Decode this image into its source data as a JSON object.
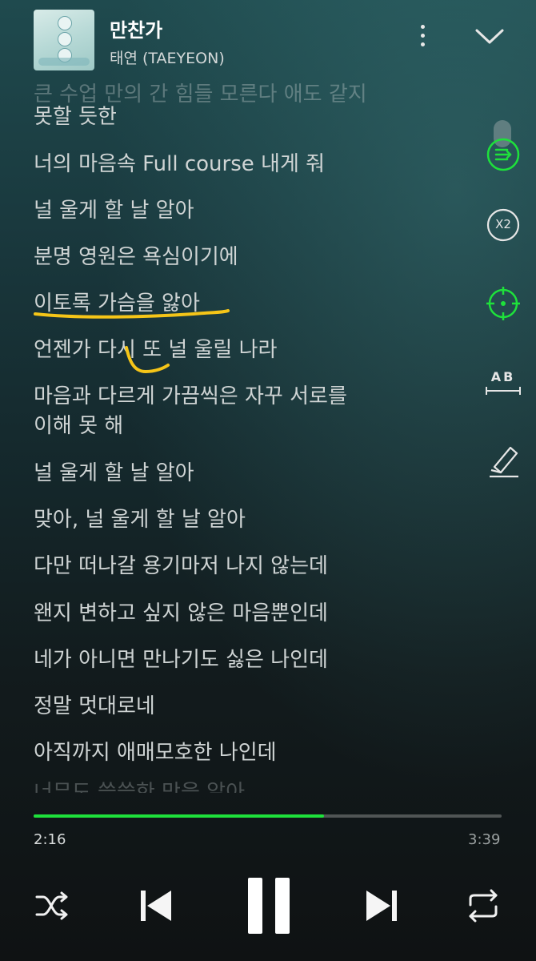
{
  "header": {
    "title": "만찬가",
    "artist": "태연 (TAEYEON)",
    "more_icon": "more-vertical-icon",
    "collapse_icon": "chevron-down-icon"
  },
  "lyrics": [
    "큰 수업 만의 간 힘들 모른다 애도 같지",
    "못할 듯한",
    "너의 마음속 Full course 내게 줘",
    "널 울게 할 날 알아",
    "분명 영원은 욕심이기에",
    "이토록 가슴을 앓아",
    "언젠가 다시 또 널 울릴 나라",
    "마음과 다르게 가끔씩은 자꾸 서로를",
    "이해 못 해",
    "널 울게 할 날 알아",
    "맞아, 널 울게 할 날 알아",
    "다만 떠나갈 용기마저 나지 않는데",
    "왠지 변하고 싶지 않은 마음뿐인데",
    "네가 아니면 만나기도 싫은 나인데",
    "정말 멋대로네",
    "아직까지 애매모호한 나인데",
    "너무도 쓸쓸한 맛을 알아"
  ],
  "tools": {
    "autoscroll": "lyrics-autoscroll-icon",
    "speed": "X2",
    "focus": "target-focus-icon",
    "font": "AB",
    "highlight": "highlighter-icon"
  },
  "progress": {
    "current": "2:16",
    "total": "3:39",
    "fraction": 0.621,
    "color": "#1ee13b"
  },
  "controls": {
    "shuffle": "shuffle-icon",
    "previous": "skip-previous-icon",
    "play_pause": "pause-icon",
    "next": "skip-next-icon",
    "repeat": "repeat-icon"
  },
  "colors": {
    "accent": "#1ee13b",
    "annotation": "#f5c518"
  }
}
